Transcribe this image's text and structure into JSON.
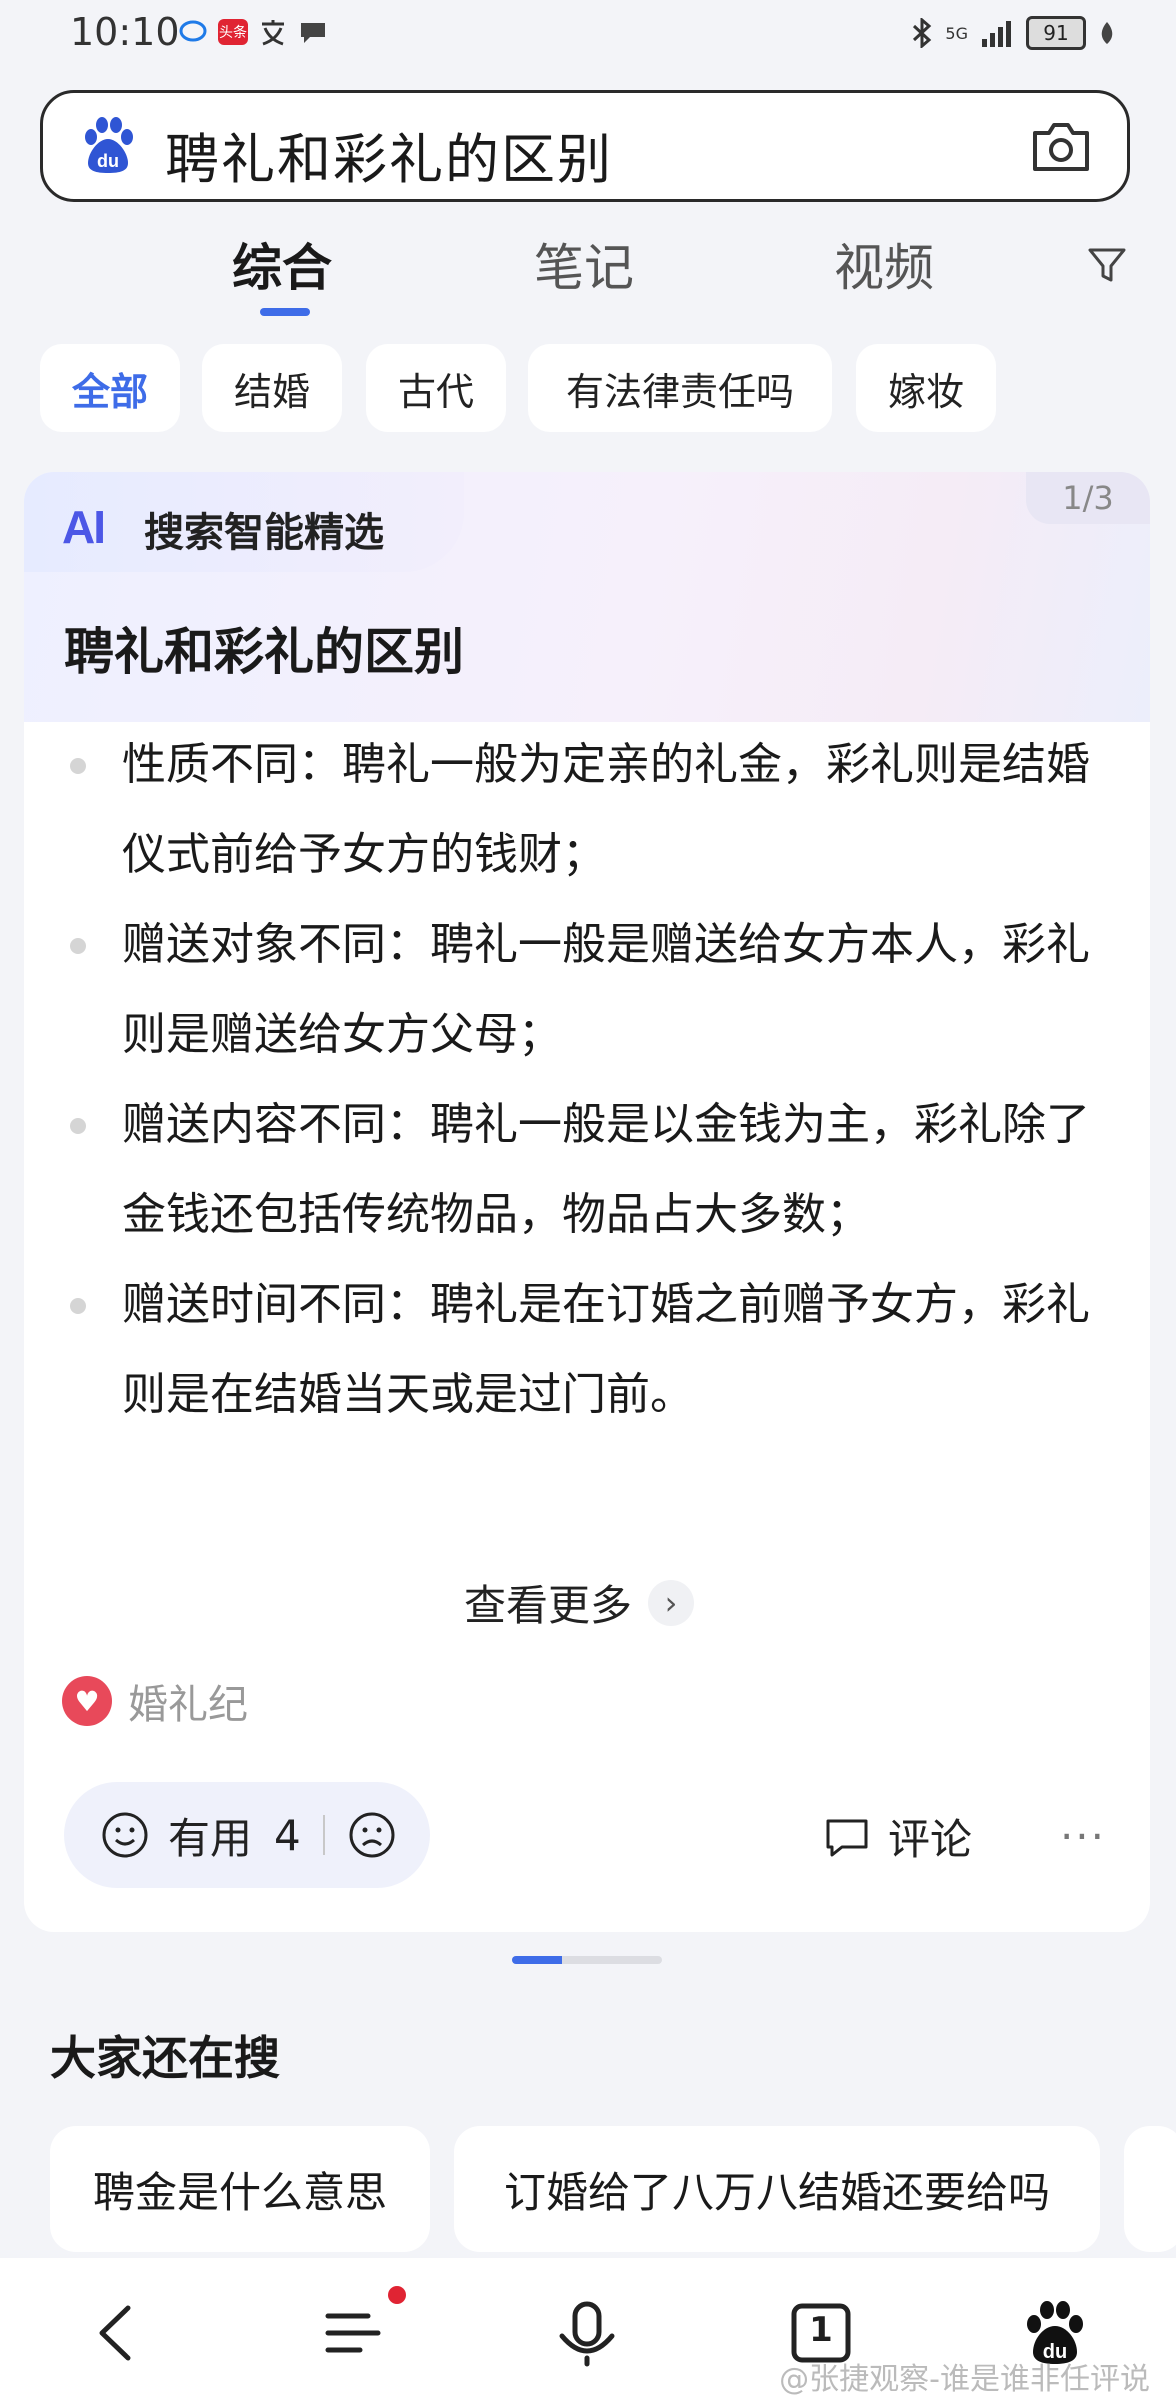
{
  "status_bar": {
    "time": "10:10",
    "battery": "91",
    "network": "5G"
  },
  "search": {
    "query": "聘礼和彩礼的区别"
  },
  "tabs": [
    {
      "label": "综合",
      "active": true
    },
    {
      "label": "笔记",
      "active": false
    },
    {
      "label": "视频",
      "active": false
    }
  ],
  "chips": [
    {
      "label": "全部",
      "active": true
    },
    {
      "label": "结婚",
      "active": false
    },
    {
      "label": "古代",
      "active": false
    },
    {
      "label": "有法律责任吗",
      "active": false
    },
    {
      "label": "嫁妆",
      "active": false
    }
  ],
  "ai_card": {
    "badge_logo": "AI",
    "badge_text": "搜索智能精选",
    "page_indicator": "1/3",
    "title": "聘礼和彩礼的区别",
    "bullets": [
      "性质不同：聘礼一般为定亲的礼金，彩礼则是结婚仪式前给予女方的钱财；",
      "赠送对象不同：聘礼一般是赠送给女方本人，彩礼则是赠送给女方父母；",
      "赠送内容不同：聘礼一般是以金钱为主，彩礼除了金钱还包括传统物品，物品占大多数；",
      "赠送时间不同：聘礼是在订婚之前赠予女方，彩礼则是在结婚当天或是过门前。"
    ],
    "see_more": "查看更多",
    "source_name": "婚礼纪",
    "useful_label": "有用",
    "useful_count": "4",
    "comment_label": "评论",
    "more_dots": "···"
  },
  "related": {
    "title": "大家还在搜",
    "items": [
      "聘金是什么意思",
      "订婚给了八万八结婚还要给吗"
    ]
  },
  "bottom_nav": {
    "tab_count": "1",
    "watermark": "@张捷观察-谁是谁非任评说"
  },
  "colors": {
    "accent": "#3e6ce8",
    "notification": "#e02433"
  }
}
